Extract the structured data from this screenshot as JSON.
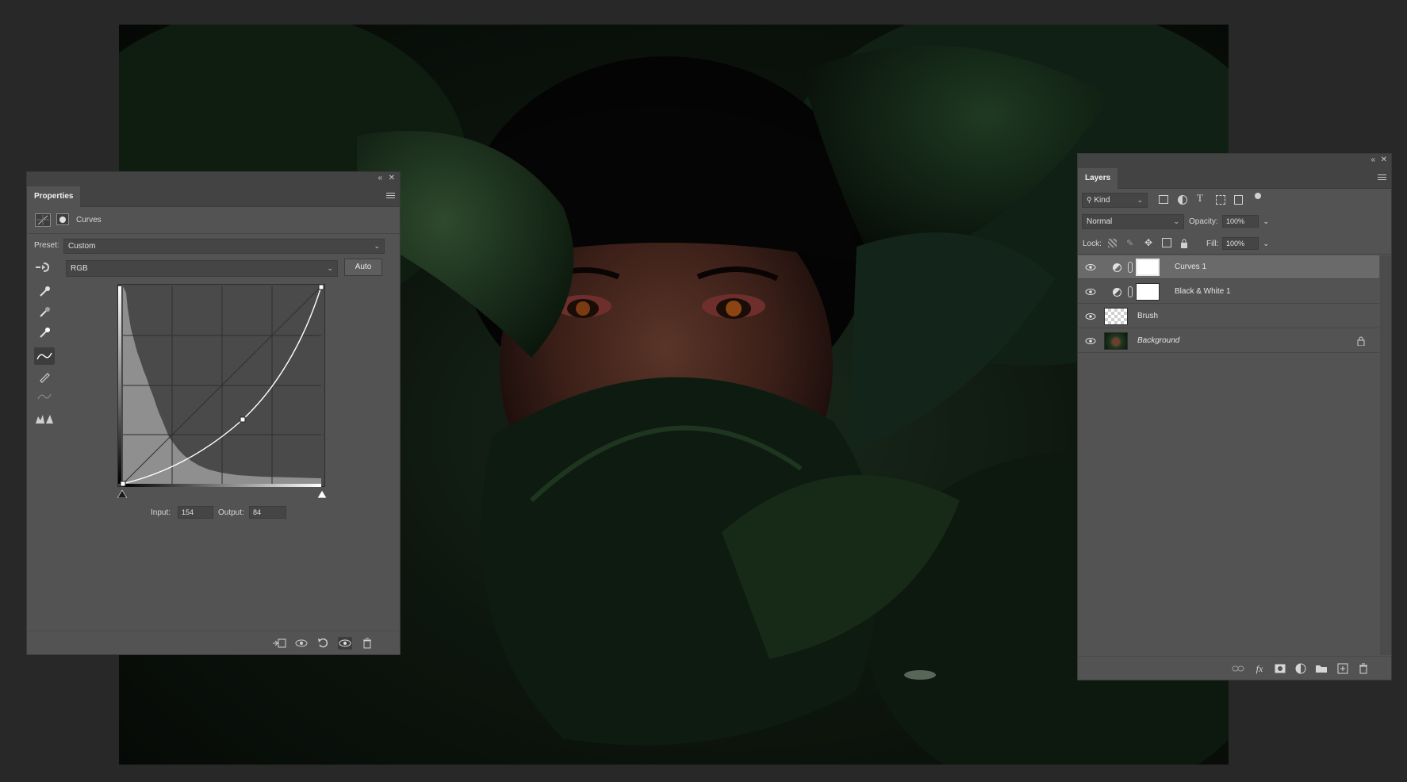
{
  "properties": {
    "tab_title": "Properties",
    "adjustment_name": "Curves",
    "preset_label": "Preset:",
    "preset_value": "Custom",
    "channel_value": "RGB",
    "auto_label": "Auto",
    "input_label": "Input:",
    "input_value": "154",
    "output_label": "Output:",
    "output_value": "84",
    "tools": [
      "hand-target-icon",
      "eyedropper-black-icon",
      "eyedropper-gray-icon",
      "eyedropper-white-icon",
      "curve-points-icon",
      "pencil-icon",
      "smooth-icon",
      "clipping-warning-icon"
    ],
    "bottom_icons": [
      "clip-to-layer-icon",
      "view-previous-icon",
      "reset-icon",
      "visibility-icon",
      "trash-icon"
    ]
  },
  "layers": {
    "tab_title": "Layers",
    "filter_kind": "Kind",
    "blend_mode": "Normal",
    "opacity_label": "Opacity:",
    "opacity_value": "100%",
    "lock_label": "Lock:",
    "fill_label": "Fill:",
    "fill_value": "100%",
    "items": [
      {
        "name": "Curves 1",
        "type": "adjustment",
        "selected": true
      },
      {
        "name": "Black & White 1",
        "type": "adjustment",
        "selected": false
      },
      {
        "name": "Brush",
        "type": "transparent",
        "selected": false
      },
      {
        "name": "Background",
        "type": "image",
        "selected": false,
        "locked": true
      }
    ],
    "bottom_icons": [
      "link-icon",
      "fx-icon",
      "mask-icon",
      "adjustment-icon",
      "folder-icon",
      "new-layer-icon",
      "trash-icon"
    ]
  },
  "colors": {
    "panel_bg": "#535353",
    "panel_header": "#434343",
    "canvas_bg": "#282828",
    "selected_row": "#6a6a6a"
  }
}
